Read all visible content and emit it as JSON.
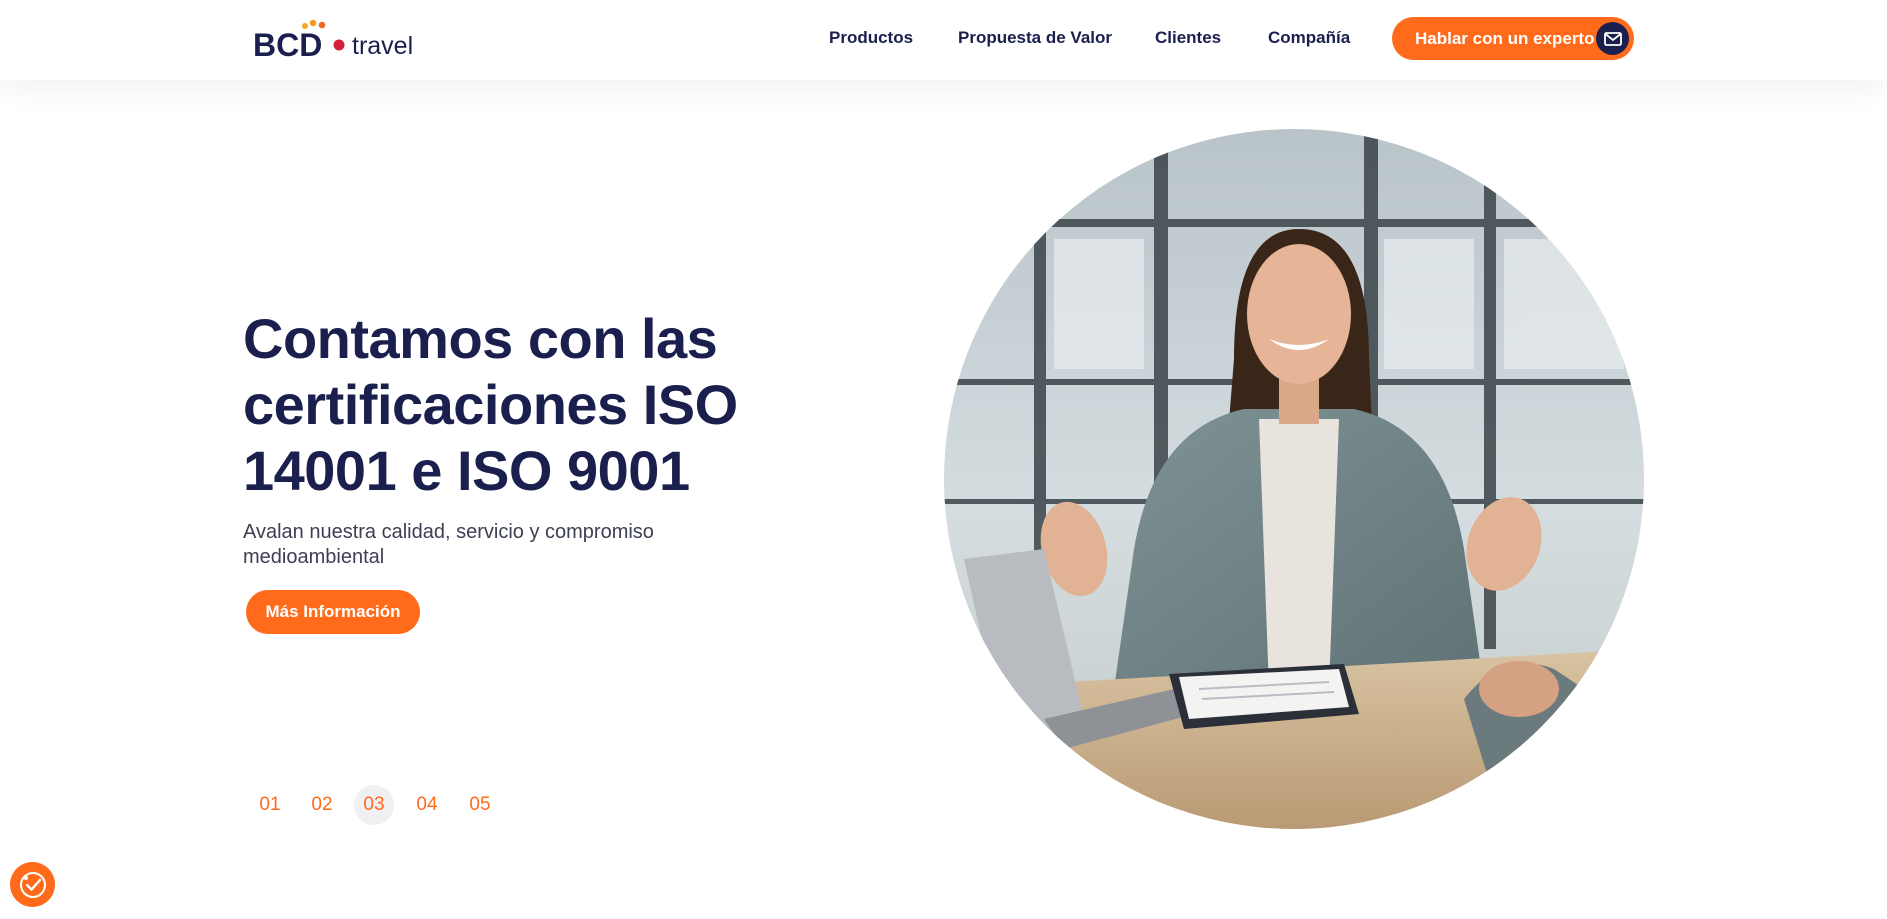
{
  "header": {
    "logo_text": "BCD travel",
    "nav": [
      {
        "label": "Productos"
      },
      {
        "label": "Propuesta de Valor"
      },
      {
        "label": "Clientes"
      },
      {
        "label": "Compañía"
      }
    ],
    "cta_label": "Hablar con un experto",
    "cta_icon": "mail-icon"
  },
  "hero": {
    "title": "Contamos con las certificaciones ISO 14001 e ISO 9001",
    "subtitle": "Avalan nuestra calidad, servicio y compromiso medioambiental",
    "button_label": "Más Información",
    "image_icon": "business-meeting-photo"
  },
  "pagination": {
    "items": [
      "01",
      "02",
      "03",
      "04",
      "05"
    ],
    "active": "03"
  },
  "accessibility": {
    "icon": "accessibility-settings-icon"
  },
  "colors": {
    "accent": "#ff6b1a",
    "navy": "#1a1f4e",
    "logo_red": "#d21f3c",
    "logo_orange": "#f5a623"
  }
}
